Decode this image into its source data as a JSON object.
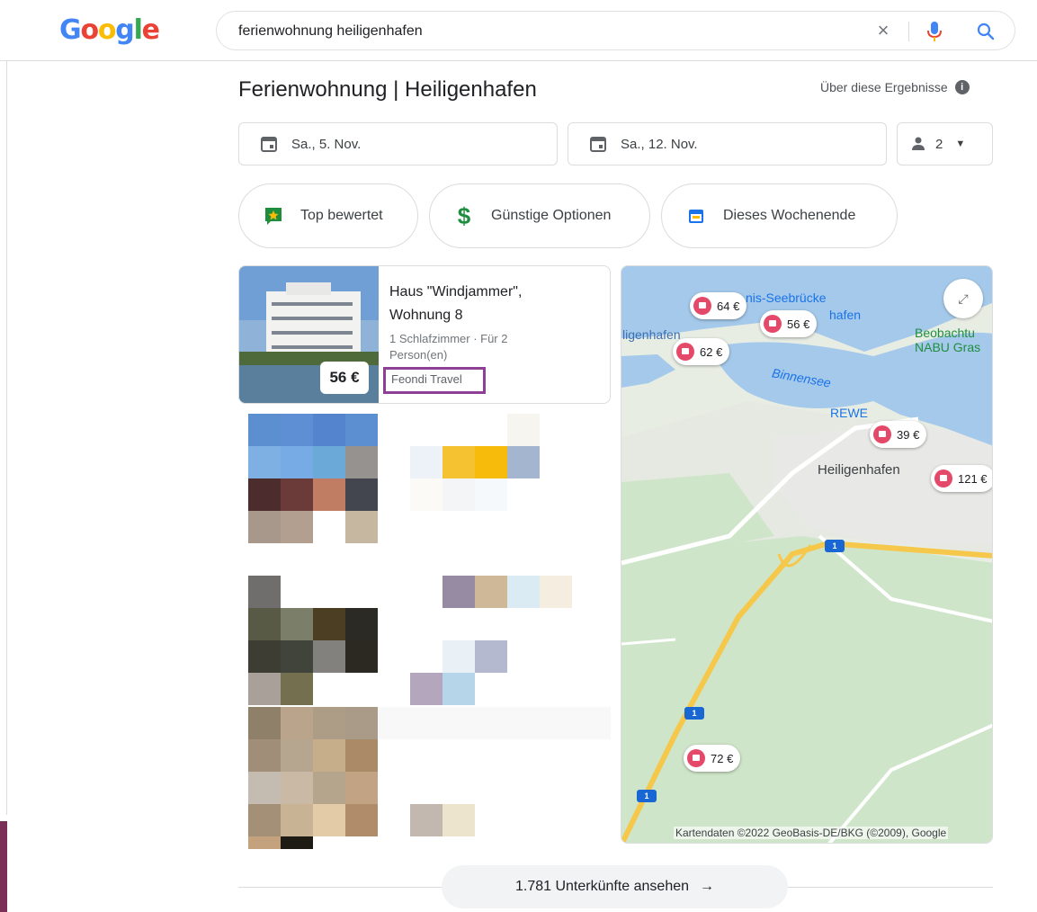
{
  "logo": {
    "letters": [
      "G",
      "o",
      "o",
      "g",
      "l",
      "e"
    ],
    "colors": [
      "#4285f4",
      "#ea4335",
      "#fbbc05",
      "#4285f4",
      "#34a853",
      "#ea4335"
    ]
  },
  "search": {
    "query": "ferienwohnung heiligenhafen",
    "clear_icon": "close-icon",
    "mic_icon": "mic-icon",
    "search_icon": "search-icon"
  },
  "panel": {
    "title": "Ferienwohnung | Heiligenhafen",
    "about_label": "Über diese Ergebnisse",
    "checkin": "Sa., 5. Nov.",
    "checkout": "Sa., 12. Nov.",
    "guests": "2"
  },
  "filters": [
    {
      "label": "Top bewertet",
      "icon": "star-flag-icon",
      "color": "#1e8e3e"
    },
    {
      "label": "Günstige Optionen",
      "icon": "dollar-icon",
      "color": "#1e8e3e"
    },
    {
      "label": "Dieses Wochenende",
      "icon": "calendar-icon",
      "color": "#1a73e8"
    }
  ],
  "listings": [
    {
      "price": "56 €",
      "title": "Haus \"Windjammer\", Wohnung 8",
      "details": "1 Schlafzimmer · Für 2 Person(en)",
      "provider": "Feondi Travel"
    }
  ],
  "map": {
    "water_labels": [
      "nis-Seebrücke",
      "hafen",
      "Binnensee",
      "ligenhafen",
      "Beobachtu",
      "NABU Gras"
    ],
    "places": [
      "REWE",
      "Heiligenhafen"
    ],
    "pins": [
      "64 €",
      "56 €",
      "62 €",
      "39 €",
      "121 €",
      "72 €"
    ],
    "highway": "1",
    "attribution": "Kartendaten ©2022 GeoBasis-DE/BKG (©2009), Google",
    "colors": {
      "land": "#e8ede4",
      "water": "#a5c9ea",
      "green": "#cfe5c9",
      "road": "#f5c84c",
      "pin": "#e5496a"
    }
  },
  "footer": {
    "more_label": "1.781 Unterkünfte ansehen",
    "arrow": "→"
  }
}
